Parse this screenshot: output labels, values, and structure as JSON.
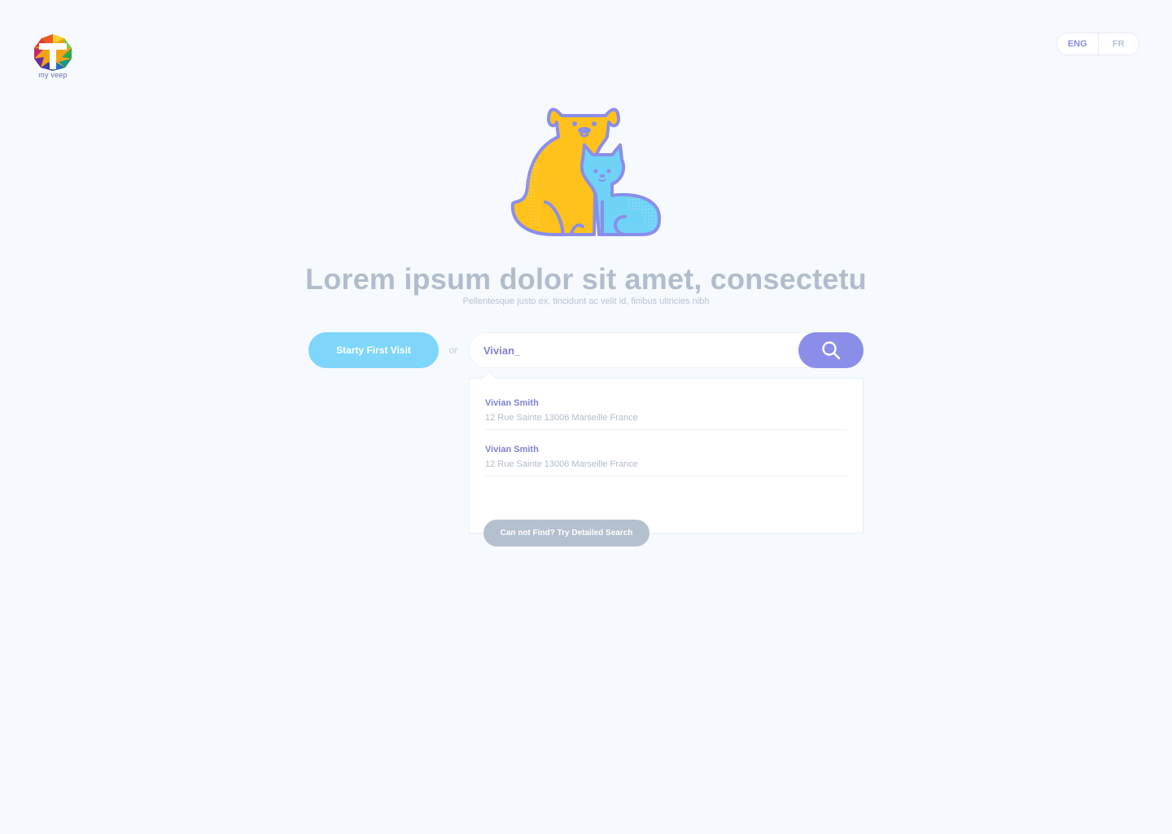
{
  "brand": {
    "logo_text": "my veep"
  },
  "language": {
    "options": [
      "ENG",
      "FR"
    ],
    "selected": "ENG"
  },
  "hero": {
    "title": "Lorem ipsum dolor sit amet, consectetu",
    "subtitle": "Pellentesque justo ex, tincidunt ac velit id, finibus ultricies nibh"
  },
  "actions": {
    "start_label": "Starty First Visit",
    "or_label": "or"
  },
  "search": {
    "value": "Vivian_",
    "icon": "search-icon"
  },
  "results": [
    {
      "name": "Vivian Smith",
      "address": "12 Rue Sainte 13006 Marseille France"
    },
    {
      "name": "Vivian Smith",
      "address": "12 Rue Sainte 13006 Marseille France"
    }
  ],
  "detailed_search_label": "Can not Find? Try Detailed Search",
  "colors": {
    "background": "#f6f9fd",
    "accent_purple": "#8b8ee8",
    "accent_blue": "#7fd6fb",
    "muted_text": "#b1bdcd",
    "dog_yellow": "#ffc21c",
    "cat_blue": "#6fd3f7"
  }
}
